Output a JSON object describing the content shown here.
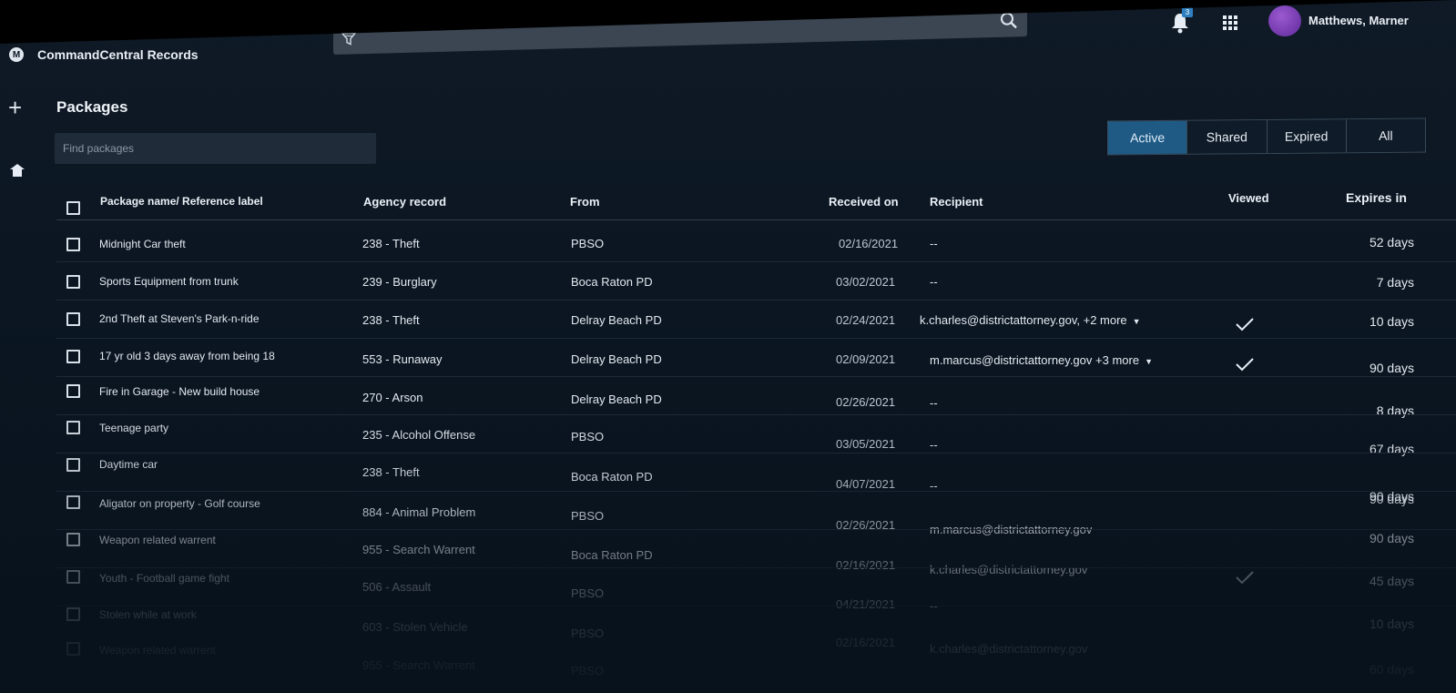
{
  "app": {
    "title": "CommandCentral Records",
    "logo_letter": "M"
  },
  "header": {
    "notifications_count": "3",
    "user_name": "Matthews, Marner"
  },
  "page": {
    "title": "Packages",
    "search_placeholder": "Find packages",
    "tabs": [
      {
        "label": "Active",
        "active": true
      },
      {
        "label": "Shared",
        "active": false
      },
      {
        "label": "Expired",
        "active": false
      },
      {
        "label": "All",
        "active": false
      }
    ]
  },
  "table": {
    "columns": {
      "name": "Package name/ Reference label",
      "agency": "Agency record",
      "from": "From",
      "received": "Received on",
      "recipient": "Recipient",
      "viewed": "Viewed",
      "expires": "Expires in"
    },
    "rows": [
      {
        "name": "Midnight Car theft",
        "agency": "238 - Theft",
        "from": "PBSO",
        "received": "02/16/2021",
        "recipient": "--",
        "viewed": false,
        "expires": "52 days"
      },
      {
        "name": "Sports Equipment from trunk",
        "agency": "239 - Burglary",
        "from": "Boca Raton PD",
        "received": "03/02/2021",
        "recipient": "--",
        "viewed": false,
        "expires": "7 days"
      },
      {
        "name": "2nd Theft at Steven's Park-n-ride",
        "agency": "238 - Theft",
        "from": "Delray Beach PD",
        "received": "02/24/2021",
        "recipient": "k.charles@districtattorney.gov, +2 more",
        "has_more": true,
        "viewed": true,
        "expires": "10 days"
      },
      {
        "name": "17 yr old 3 days away from being 18",
        "agency": "553 - Runaway",
        "from": "Delray Beach PD",
        "received": "02/09/2021",
        "recipient": "m.marcus@districtattorney.gov +3 more",
        "has_more": true,
        "viewed": true,
        "expires": "90 days"
      },
      {
        "name": "Fire in Garage - New build house",
        "agency": "270 - Arson",
        "from": "Delray Beach PD",
        "received": "02/26/2021",
        "recipient": "--",
        "viewed": false,
        "expires": "8 days"
      },
      {
        "name": "Teenage party",
        "agency": "235 - Alcohol Offense",
        "from": "PBSO",
        "received": "03/05/2021",
        "recipient": "--",
        "viewed": false,
        "expires": "67 days"
      },
      {
        "name": "Daytime car",
        "agency": "238 - Theft",
        "from": "Boca Raton PD",
        "received": "04/07/2021",
        "recipient": "--",
        "viewed": false,
        "expires": "90 days"
      },
      {
        "name": "Aligator on property - Golf course",
        "agency": "884 - Animal Problem",
        "from": "PBSO",
        "received": "02/26/2021",
        "recipient": "m.marcus@districtattorney.gov",
        "viewed": false,
        "expires": "90 days"
      },
      {
        "name": "Weapon related warrent",
        "agency": "955 - Search Warrent",
        "from": "Boca Raton PD",
        "received": "02/16/2021",
        "recipient": "k.charles@districtattorney.gov",
        "viewed": false,
        "expires": "90 days"
      },
      {
        "name": "Youth - Football game fight",
        "agency": "506 - Assault",
        "from": "PBSO",
        "received": "04/21/2021",
        "recipient": "--",
        "viewed": true,
        "expires": "45 days"
      },
      {
        "name": "Stolen while at work",
        "agency": "603 - Stolen Vehicle",
        "from": "PBSO",
        "received": "02/16/2021",
        "recipient": "k.charles@districtattorney.gov",
        "viewed": false,
        "expires": "10 days"
      },
      {
        "name": "Weapon related warrent",
        "agency": "955 - Search Warrent",
        "from": "PBSO",
        "received": "",
        "recipient": "",
        "viewed": false,
        "expires": "60 days"
      }
    ]
  }
}
